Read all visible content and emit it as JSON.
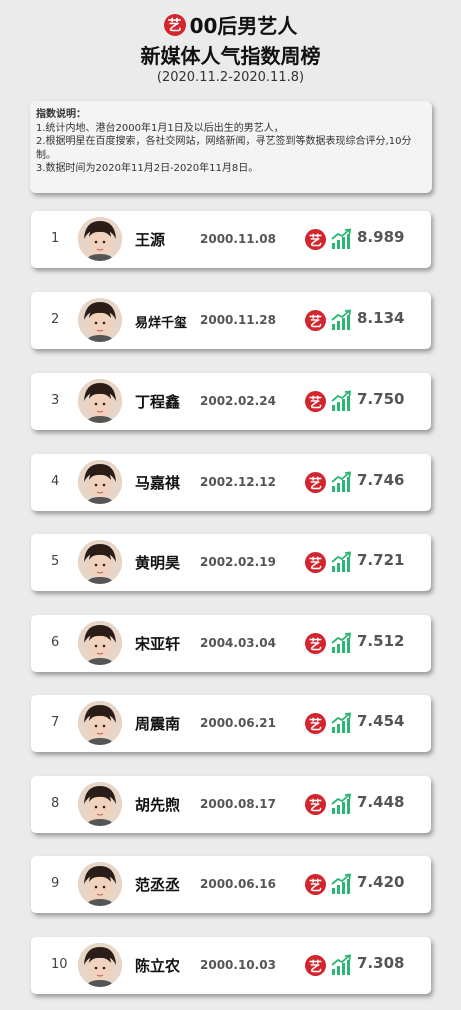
{
  "header": {
    "logo_char": "艺",
    "title_line1": "00后男艺人",
    "title_line2": "新媒体人气指数周榜",
    "date_range": "(2020.11.2-2020.11.8)"
  },
  "notes": {
    "title": "指数说明：",
    "lines": [
      "1.统计内地、港台2000年1月1日及以后出生的男艺人，",
      "2.根据明星在百度搜索，各社交网站，网络新闻，寻艺签到等数据表现综合评分,10分制。",
      "3.数据时间为2020年11月2日-2020年11月8日。"
    ]
  },
  "colors": {
    "brand_red": "#d2252e",
    "trend_green": "#2bb673"
  },
  "rows": [
    {
      "rank": "1",
      "name": "王源",
      "date": "2000.11.08",
      "score": "8.989",
      "logo": "艺",
      "icon": "trend-up-icon"
    },
    {
      "rank": "2",
      "name": "易烊千玺",
      "date": "2000.11.28",
      "score": "8.134",
      "logo": "艺",
      "icon": "trend-up-icon"
    },
    {
      "rank": "3",
      "name": "丁程鑫",
      "date": "2002.02.24",
      "score": "7.750",
      "logo": "艺",
      "icon": "trend-up-icon"
    },
    {
      "rank": "4",
      "name": "马嘉祺",
      "date": "2002.12.12",
      "score": "7.746",
      "logo": "艺",
      "icon": "trend-up-icon"
    },
    {
      "rank": "5",
      "name": "黄明昊",
      "date": "2002.02.19",
      "score": "7.721",
      "logo": "艺",
      "icon": "trend-up-icon"
    },
    {
      "rank": "6",
      "name": "宋亚轩",
      "date": "2004.03.04",
      "score": "7.512",
      "logo": "艺",
      "icon": "trend-up-icon"
    },
    {
      "rank": "7",
      "name": "周震南",
      "date": "2000.06.21",
      "score": "7.454",
      "logo": "艺",
      "icon": "trend-up-icon"
    },
    {
      "rank": "8",
      "name": "胡先煦",
      "date": "2000.08.17",
      "score": "7.448",
      "logo": "艺",
      "icon": "trend-up-icon"
    },
    {
      "rank": "9",
      "name": "范丞丞",
      "date": "2000.06.16",
      "score": "7.420",
      "logo": "艺",
      "icon": "trend-up-icon"
    },
    {
      "rank": "10",
      "name": "陈立农",
      "date": "2000.10.03",
      "score": "7.308",
      "logo": "艺",
      "icon": "trend-up-icon"
    }
  ]
}
